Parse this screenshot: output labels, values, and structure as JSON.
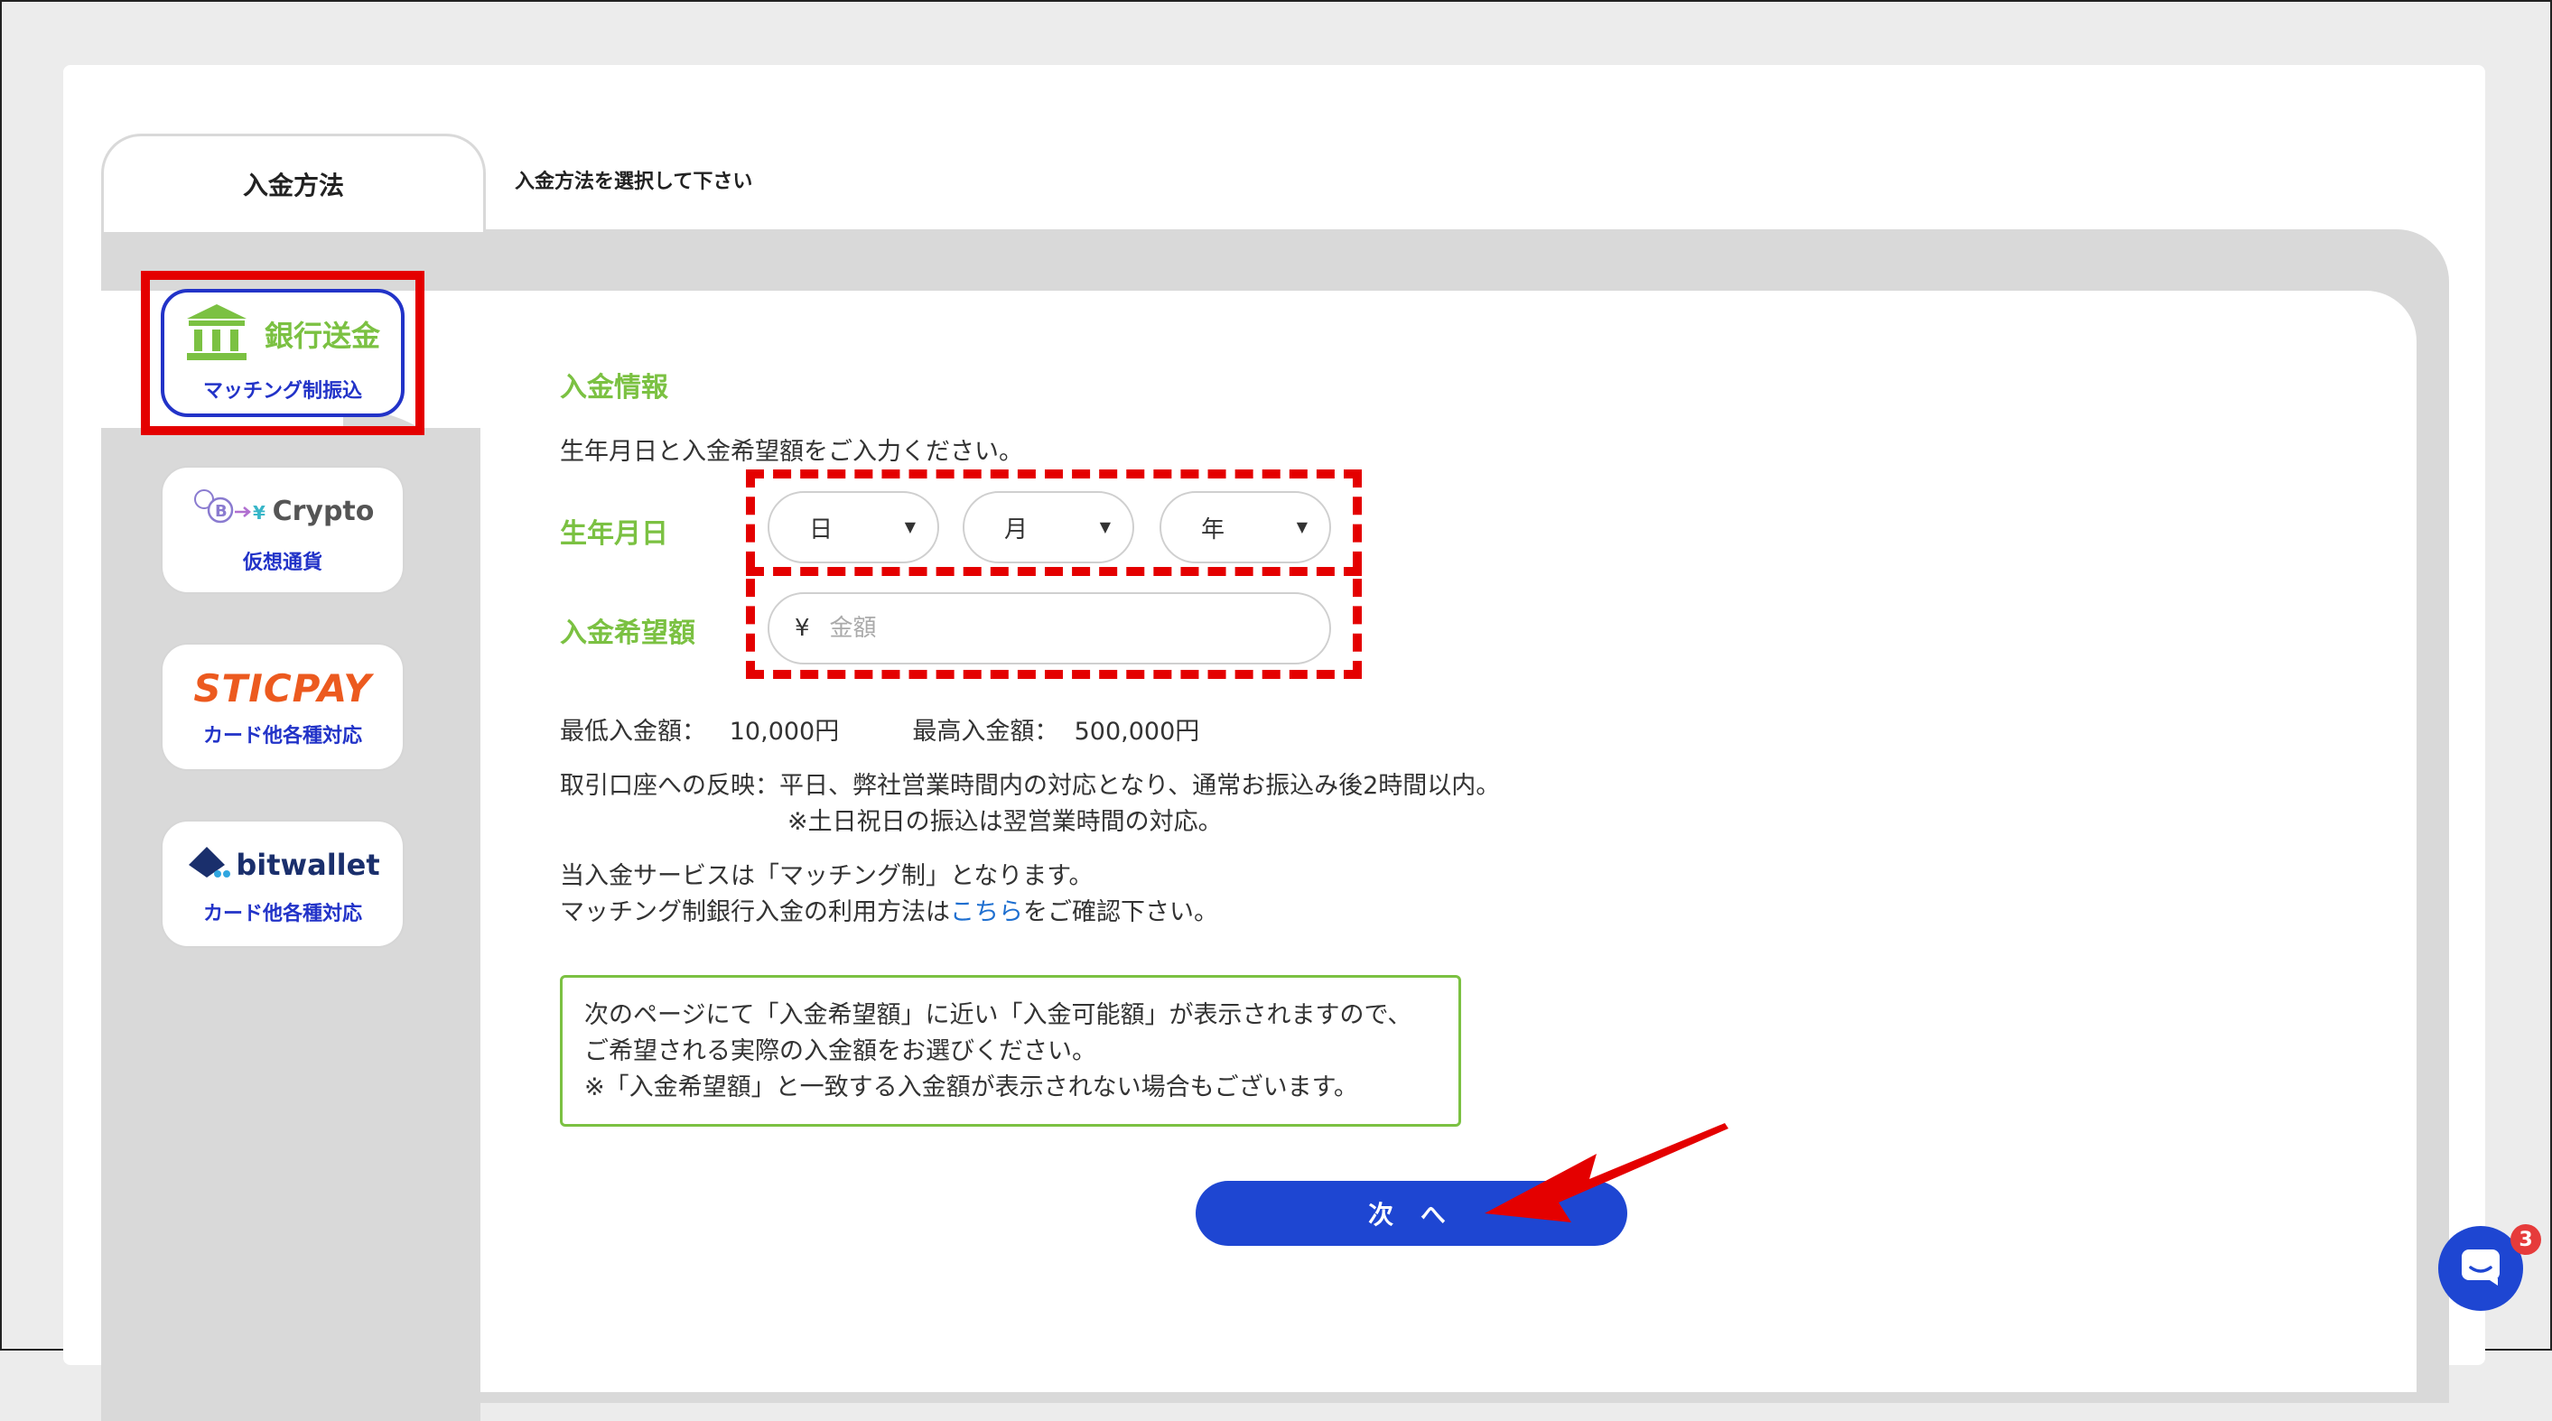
{
  "tabs": {
    "active_label": "入金方法",
    "hint": "入金方法を選択して下さい"
  },
  "methods": [
    {
      "title": "銀行送金",
      "sub": "マッチング制振込",
      "icon": "bank-icon"
    },
    {
      "title": "Crypto",
      "sub": "仮想通貨",
      "icon": "crypto-icon"
    },
    {
      "title": "STICPAY",
      "sub": "カード他各種対応",
      "icon": "sticpay-logo"
    },
    {
      "title": "bitwallet",
      "sub": "カード他各種対応",
      "icon": "bitwallet-logo"
    }
  ],
  "form": {
    "section_title": "入金情報",
    "intro": "生年月日と入金希望額をご入力ください。",
    "birth_label": "生年月日",
    "day": "日",
    "month": "月",
    "year": "年",
    "amount_label": "入金希望額",
    "currency": "¥",
    "amount_placeholder": "金額"
  },
  "limits": {
    "min_label": "最低入金額：",
    "min_value": "10,000円",
    "max_label": "最高入金額：",
    "max_value": "500,000円"
  },
  "reflection": {
    "line1": "取引口座への反映：平日、弊社営業時間内の対応となり、通常お振込み後2時間以内。",
    "line2": "※土日祝日の振込は翌営業時間の対応。"
  },
  "service": {
    "line1": "当入金サービスは「マッチング制」となります。",
    "line2_prefix": "マッチング制銀行入金の利用方法は",
    "line2_link": "こちら",
    "line2_suffix": "をご確認下さい。"
  },
  "notice": {
    "line1": "次のページにて「入金希望額」に近い「入金可能額」が表示されますので、",
    "line2": "ご希望される実際の入金額をお選びください。",
    "line3": "※「入金希望額」と一致する入金額が表示されない場合もございます。"
  },
  "next_button": "次 へ",
  "chat": {
    "badge": "3",
    "icon": "chat-icon"
  },
  "colors": {
    "accent_green": "#7bc142",
    "brand_blue": "#1e46d2",
    "annotation_red": "#e40000"
  }
}
